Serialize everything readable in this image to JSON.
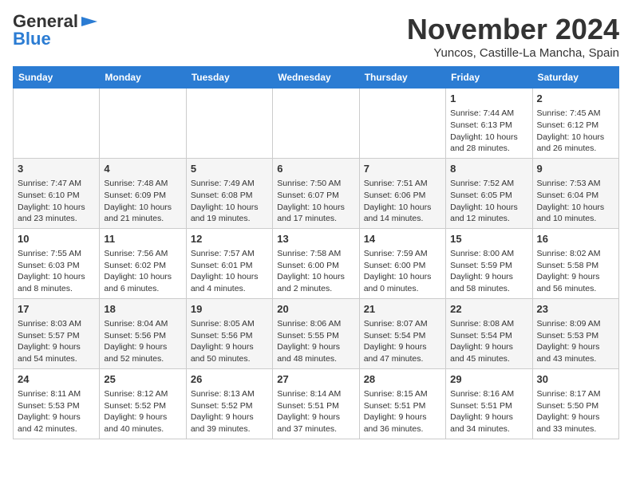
{
  "header": {
    "logo_line1": "General",
    "logo_line2": "Blue",
    "month": "November 2024",
    "location": "Yuncos, Castille-La Mancha, Spain"
  },
  "weekdays": [
    "Sunday",
    "Monday",
    "Tuesday",
    "Wednesday",
    "Thursday",
    "Friday",
    "Saturday"
  ],
  "weeks": [
    [
      {
        "day": "",
        "info": ""
      },
      {
        "day": "",
        "info": ""
      },
      {
        "day": "",
        "info": ""
      },
      {
        "day": "",
        "info": ""
      },
      {
        "day": "",
        "info": ""
      },
      {
        "day": "1",
        "info": "Sunrise: 7:44 AM\nSunset: 6:13 PM\nDaylight: 10 hours and 28 minutes."
      },
      {
        "day": "2",
        "info": "Sunrise: 7:45 AM\nSunset: 6:12 PM\nDaylight: 10 hours and 26 minutes."
      }
    ],
    [
      {
        "day": "3",
        "info": "Sunrise: 7:47 AM\nSunset: 6:10 PM\nDaylight: 10 hours and 23 minutes."
      },
      {
        "day": "4",
        "info": "Sunrise: 7:48 AM\nSunset: 6:09 PM\nDaylight: 10 hours and 21 minutes."
      },
      {
        "day": "5",
        "info": "Sunrise: 7:49 AM\nSunset: 6:08 PM\nDaylight: 10 hours and 19 minutes."
      },
      {
        "day": "6",
        "info": "Sunrise: 7:50 AM\nSunset: 6:07 PM\nDaylight: 10 hours and 17 minutes."
      },
      {
        "day": "7",
        "info": "Sunrise: 7:51 AM\nSunset: 6:06 PM\nDaylight: 10 hours and 14 minutes."
      },
      {
        "day": "8",
        "info": "Sunrise: 7:52 AM\nSunset: 6:05 PM\nDaylight: 10 hours and 12 minutes."
      },
      {
        "day": "9",
        "info": "Sunrise: 7:53 AM\nSunset: 6:04 PM\nDaylight: 10 hours and 10 minutes."
      }
    ],
    [
      {
        "day": "10",
        "info": "Sunrise: 7:55 AM\nSunset: 6:03 PM\nDaylight: 10 hours and 8 minutes."
      },
      {
        "day": "11",
        "info": "Sunrise: 7:56 AM\nSunset: 6:02 PM\nDaylight: 10 hours and 6 minutes."
      },
      {
        "day": "12",
        "info": "Sunrise: 7:57 AM\nSunset: 6:01 PM\nDaylight: 10 hours and 4 minutes."
      },
      {
        "day": "13",
        "info": "Sunrise: 7:58 AM\nSunset: 6:00 PM\nDaylight: 10 hours and 2 minutes."
      },
      {
        "day": "14",
        "info": "Sunrise: 7:59 AM\nSunset: 6:00 PM\nDaylight: 10 hours and 0 minutes."
      },
      {
        "day": "15",
        "info": "Sunrise: 8:00 AM\nSunset: 5:59 PM\nDaylight: 9 hours and 58 minutes."
      },
      {
        "day": "16",
        "info": "Sunrise: 8:02 AM\nSunset: 5:58 PM\nDaylight: 9 hours and 56 minutes."
      }
    ],
    [
      {
        "day": "17",
        "info": "Sunrise: 8:03 AM\nSunset: 5:57 PM\nDaylight: 9 hours and 54 minutes."
      },
      {
        "day": "18",
        "info": "Sunrise: 8:04 AM\nSunset: 5:56 PM\nDaylight: 9 hours and 52 minutes."
      },
      {
        "day": "19",
        "info": "Sunrise: 8:05 AM\nSunset: 5:56 PM\nDaylight: 9 hours and 50 minutes."
      },
      {
        "day": "20",
        "info": "Sunrise: 8:06 AM\nSunset: 5:55 PM\nDaylight: 9 hours and 48 minutes."
      },
      {
        "day": "21",
        "info": "Sunrise: 8:07 AM\nSunset: 5:54 PM\nDaylight: 9 hours and 47 minutes."
      },
      {
        "day": "22",
        "info": "Sunrise: 8:08 AM\nSunset: 5:54 PM\nDaylight: 9 hours and 45 minutes."
      },
      {
        "day": "23",
        "info": "Sunrise: 8:09 AM\nSunset: 5:53 PM\nDaylight: 9 hours and 43 minutes."
      }
    ],
    [
      {
        "day": "24",
        "info": "Sunrise: 8:11 AM\nSunset: 5:53 PM\nDaylight: 9 hours and 42 minutes."
      },
      {
        "day": "25",
        "info": "Sunrise: 8:12 AM\nSunset: 5:52 PM\nDaylight: 9 hours and 40 minutes."
      },
      {
        "day": "26",
        "info": "Sunrise: 8:13 AM\nSunset: 5:52 PM\nDaylight: 9 hours and 39 minutes."
      },
      {
        "day": "27",
        "info": "Sunrise: 8:14 AM\nSunset: 5:51 PM\nDaylight: 9 hours and 37 minutes."
      },
      {
        "day": "28",
        "info": "Sunrise: 8:15 AM\nSunset: 5:51 PM\nDaylight: 9 hours and 36 minutes."
      },
      {
        "day": "29",
        "info": "Sunrise: 8:16 AM\nSunset: 5:51 PM\nDaylight: 9 hours and 34 minutes."
      },
      {
        "day": "30",
        "info": "Sunrise: 8:17 AM\nSunset: 5:50 PM\nDaylight: 9 hours and 33 minutes."
      }
    ]
  ]
}
